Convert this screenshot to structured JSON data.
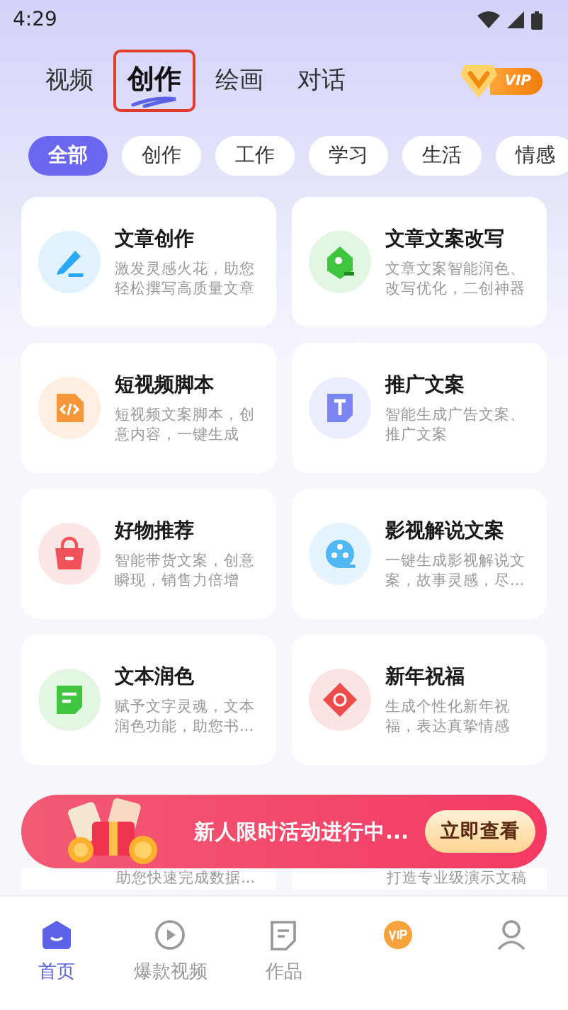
{
  "status_bar": {
    "time": "4:29"
  },
  "top_tabs": [
    {
      "label": "视频",
      "selected": false
    },
    {
      "label": "创作",
      "selected": true
    },
    {
      "label": "绘画",
      "selected": false
    },
    {
      "label": "对话",
      "selected": false
    }
  ],
  "vip_badge": {
    "label": "VIP"
  },
  "chips": [
    {
      "label": "全部",
      "selected": true
    },
    {
      "label": "创作",
      "selected": false
    },
    {
      "label": "工作",
      "selected": false
    },
    {
      "label": "学习",
      "selected": false
    },
    {
      "label": "生活",
      "selected": false
    },
    {
      "label": "情感",
      "selected": false
    }
  ],
  "cards": [
    {
      "title": "文章创作",
      "desc": "激发灵感火花，助您轻松撰写高质量文章",
      "color": "#2aa8f5"
    },
    {
      "title": "文章文案改写",
      "desc": "文章文案智能润色、改写优化，二创神器",
      "color": "#3fc53f"
    },
    {
      "title": "短视频脚本",
      "desc": "短视频文案脚本，创意内容，一键生成",
      "color": "#f7963a"
    },
    {
      "title": "推广文案",
      "desc": "智能生成广告文案、推广文案",
      "color": "#7c86f2"
    },
    {
      "title": "好物推荐",
      "desc": "智能带货文案，创意瞬现，销售力倍增",
      "color": "#f0545a"
    },
    {
      "title": "影视解说文案",
      "desc": "一键生成影视解说文案，故事灵感，尽...",
      "color": "#4fb8f5"
    },
    {
      "title": "文本润色",
      "desc": "赋予文字灵魂，文本润色功能，助您书...",
      "color": "#3fc53f"
    },
    {
      "title": "新年祝福",
      "desc": "生成个性化新年祝福，表达真挚情感",
      "color": "#ee4b4b"
    }
  ],
  "promo_banner": {
    "text": "新人限时活动进行中...",
    "button": "立即查看"
  },
  "partial_cards": [
    {
      "desc": "助您快速完成数据..."
    },
    {
      "desc": "打造专业级演示文稿"
    }
  ],
  "bottom_nav": [
    {
      "label": "首页",
      "selected": true
    },
    {
      "label": "爆款视频",
      "selected": false
    },
    {
      "label": "作品",
      "selected": false
    },
    {
      "selected": false
    },
    {
      "selected": false
    }
  ]
}
